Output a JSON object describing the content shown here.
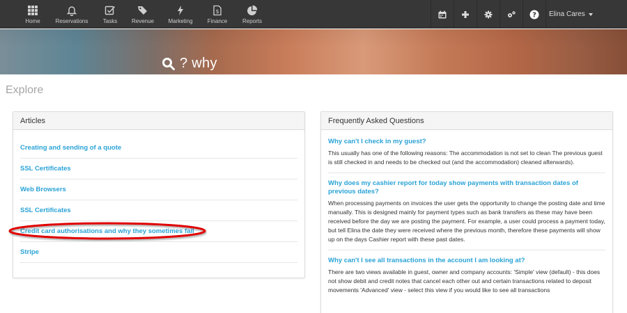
{
  "navbar": {
    "items": [
      {
        "label": "Home",
        "icon": "grid-icon"
      },
      {
        "label": "Reservations",
        "icon": "bell-icon"
      },
      {
        "label": "Tasks",
        "icon": "checkbox-icon"
      },
      {
        "label": "Revenue",
        "icon": "tag-icon"
      },
      {
        "label": "Marketing",
        "icon": "lightning-icon"
      },
      {
        "label": "Finance",
        "icon": "dollar-file-icon"
      },
      {
        "label": "Reports",
        "icon": "pie-chart-icon"
      }
    ],
    "right_icons": [
      "calendar-icon",
      "plus-icon",
      "gear-icon",
      "cogs-icon",
      "help-icon"
    ],
    "user": "Elina Cares"
  },
  "hero": {
    "query": "? why"
  },
  "page": {
    "heading": "Explore"
  },
  "articles": {
    "title": "Articles",
    "items": [
      "Creating and sending of a quote",
      "SSL Certificates",
      "Web Browsers",
      "SSL Certificates",
      "Credit card authorisations and why they sometimes fail",
      "Stripe"
    ]
  },
  "faq": {
    "title": "Frequently Asked Questions",
    "entries": [
      {
        "question": "Why can't I check in my guest?",
        "answer": "This usually has one of the following reasons:  The accommodation is not set to clean The previous guest is still checked in and needs to be checked out (and the accommodation) cleaned afterwards)."
      },
      {
        "question": "Why does my cashier report for today show payments with transaction dates of previous dates?",
        "answer": "When processing payments on invoices the user gets the opportunity to change the posting date and time manually. This is designed mainly for payment types such as bank transfers as these may have been received before the day we are posting the payment.  For example, a user could process a payment today, but tell Elina the date they were received where the previous month, therefore these payments will show up on the days Cashier report with these past dates."
      },
      {
        "question": "Why can't I see all transactions in the account I am looking at?",
        "answer": "There are two views available in guest, owner and company accounts:  'Simple' view (default) - this does not show debit and credit notes that cancel each other out and certain transactions related to deposit movements 'Advanced' view - select this view if you would like to see all transactions"
      }
    ]
  },
  "colors": {
    "navbar": "#373737",
    "link": "#2aa3d6",
    "highlight": "#e00000"
  }
}
